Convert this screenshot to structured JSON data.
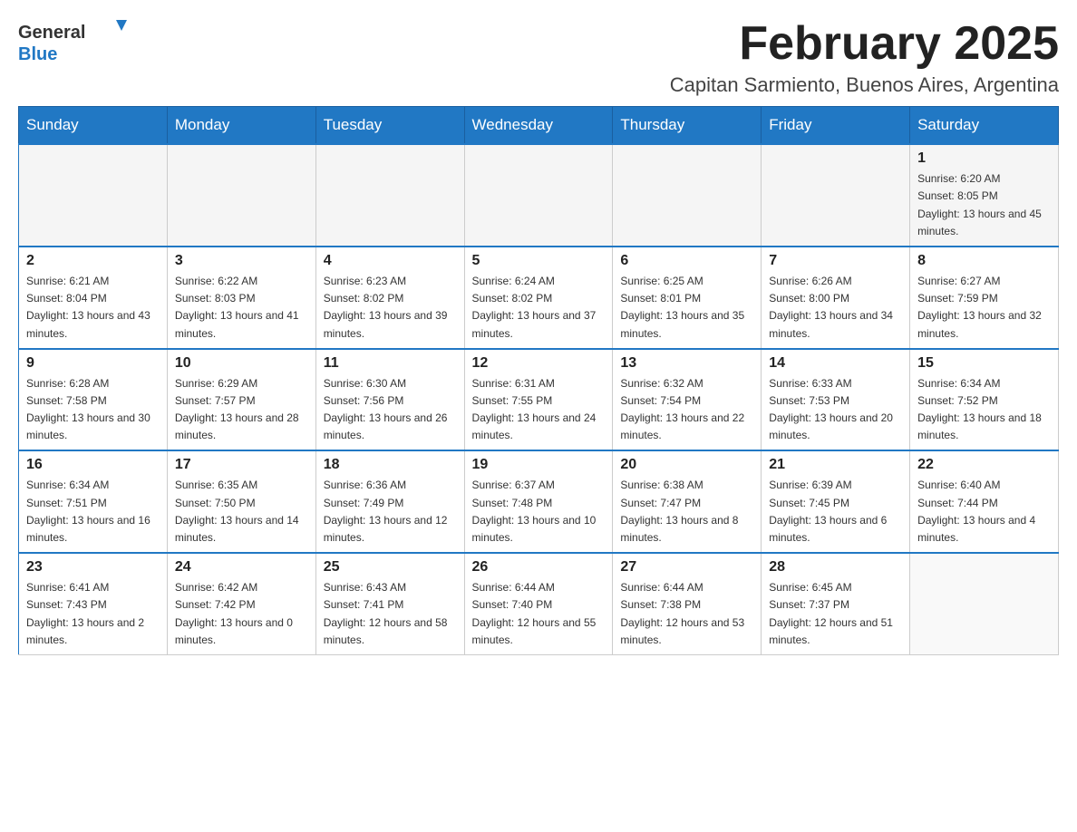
{
  "header": {
    "logo_text_general": "General",
    "logo_text_blue": "Blue",
    "month_year": "February 2025",
    "location": "Capitan Sarmiento, Buenos Aires, Argentina"
  },
  "days_of_week": [
    "Sunday",
    "Monday",
    "Tuesday",
    "Wednesday",
    "Thursday",
    "Friday",
    "Saturday"
  ],
  "weeks": [
    {
      "days": [
        {
          "number": "",
          "info": ""
        },
        {
          "number": "",
          "info": ""
        },
        {
          "number": "",
          "info": ""
        },
        {
          "number": "",
          "info": ""
        },
        {
          "number": "",
          "info": ""
        },
        {
          "number": "",
          "info": ""
        },
        {
          "number": "1",
          "info": "Sunrise: 6:20 AM\nSunset: 8:05 PM\nDaylight: 13 hours and 45 minutes."
        }
      ]
    },
    {
      "days": [
        {
          "number": "2",
          "info": "Sunrise: 6:21 AM\nSunset: 8:04 PM\nDaylight: 13 hours and 43 minutes."
        },
        {
          "number": "3",
          "info": "Sunrise: 6:22 AM\nSunset: 8:03 PM\nDaylight: 13 hours and 41 minutes."
        },
        {
          "number": "4",
          "info": "Sunrise: 6:23 AM\nSunset: 8:02 PM\nDaylight: 13 hours and 39 minutes."
        },
        {
          "number": "5",
          "info": "Sunrise: 6:24 AM\nSunset: 8:02 PM\nDaylight: 13 hours and 37 minutes."
        },
        {
          "number": "6",
          "info": "Sunrise: 6:25 AM\nSunset: 8:01 PM\nDaylight: 13 hours and 35 minutes."
        },
        {
          "number": "7",
          "info": "Sunrise: 6:26 AM\nSunset: 8:00 PM\nDaylight: 13 hours and 34 minutes."
        },
        {
          "number": "8",
          "info": "Sunrise: 6:27 AM\nSunset: 7:59 PM\nDaylight: 13 hours and 32 minutes."
        }
      ]
    },
    {
      "days": [
        {
          "number": "9",
          "info": "Sunrise: 6:28 AM\nSunset: 7:58 PM\nDaylight: 13 hours and 30 minutes."
        },
        {
          "number": "10",
          "info": "Sunrise: 6:29 AM\nSunset: 7:57 PM\nDaylight: 13 hours and 28 minutes."
        },
        {
          "number": "11",
          "info": "Sunrise: 6:30 AM\nSunset: 7:56 PM\nDaylight: 13 hours and 26 minutes."
        },
        {
          "number": "12",
          "info": "Sunrise: 6:31 AM\nSunset: 7:55 PM\nDaylight: 13 hours and 24 minutes."
        },
        {
          "number": "13",
          "info": "Sunrise: 6:32 AM\nSunset: 7:54 PM\nDaylight: 13 hours and 22 minutes."
        },
        {
          "number": "14",
          "info": "Sunrise: 6:33 AM\nSunset: 7:53 PM\nDaylight: 13 hours and 20 minutes."
        },
        {
          "number": "15",
          "info": "Sunrise: 6:34 AM\nSunset: 7:52 PM\nDaylight: 13 hours and 18 minutes."
        }
      ]
    },
    {
      "days": [
        {
          "number": "16",
          "info": "Sunrise: 6:34 AM\nSunset: 7:51 PM\nDaylight: 13 hours and 16 minutes."
        },
        {
          "number": "17",
          "info": "Sunrise: 6:35 AM\nSunset: 7:50 PM\nDaylight: 13 hours and 14 minutes."
        },
        {
          "number": "18",
          "info": "Sunrise: 6:36 AM\nSunset: 7:49 PM\nDaylight: 13 hours and 12 minutes."
        },
        {
          "number": "19",
          "info": "Sunrise: 6:37 AM\nSunset: 7:48 PM\nDaylight: 13 hours and 10 minutes."
        },
        {
          "number": "20",
          "info": "Sunrise: 6:38 AM\nSunset: 7:47 PM\nDaylight: 13 hours and 8 minutes."
        },
        {
          "number": "21",
          "info": "Sunrise: 6:39 AM\nSunset: 7:45 PM\nDaylight: 13 hours and 6 minutes."
        },
        {
          "number": "22",
          "info": "Sunrise: 6:40 AM\nSunset: 7:44 PM\nDaylight: 13 hours and 4 minutes."
        }
      ]
    },
    {
      "days": [
        {
          "number": "23",
          "info": "Sunrise: 6:41 AM\nSunset: 7:43 PM\nDaylight: 13 hours and 2 minutes."
        },
        {
          "number": "24",
          "info": "Sunrise: 6:42 AM\nSunset: 7:42 PM\nDaylight: 13 hours and 0 minutes."
        },
        {
          "number": "25",
          "info": "Sunrise: 6:43 AM\nSunset: 7:41 PM\nDaylight: 12 hours and 58 minutes."
        },
        {
          "number": "26",
          "info": "Sunrise: 6:44 AM\nSunset: 7:40 PM\nDaylight: 12 hours and 55 minutes."
        },
        {
          "number": "27",
          "info": "Sunrise: 6:44 AM\nSunset: 7:38 PM\nDaylight: 12 hours and 53 minutes."
        },
        {
          "number": "28",
          "info": "Sunrise: 6:45 AM\nSunset: 7:37 PM\nDaylight: 12 hours and 51 minutes."
        },
        {
          "number": "",
          "info": ""
        }
      ]
    }
  ]
}
